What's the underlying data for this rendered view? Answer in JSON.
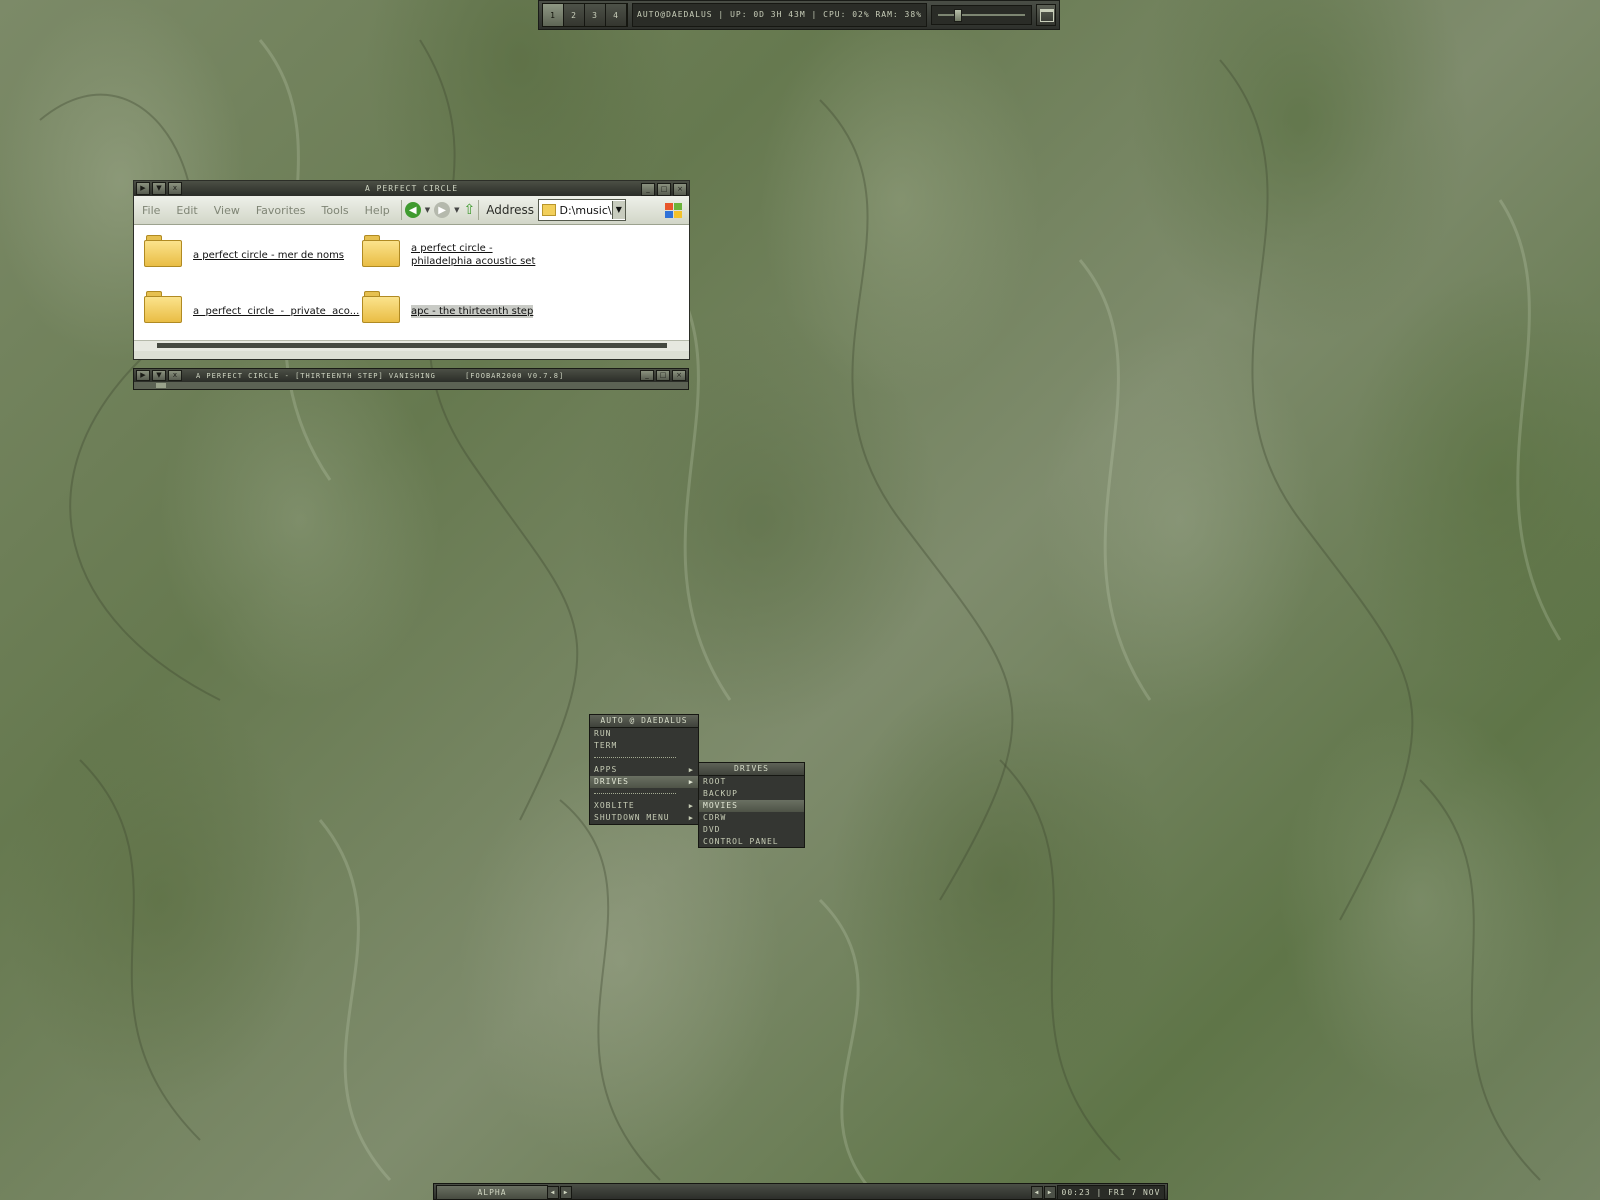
{
  "topbar": {
    "workspaces": [
      "1",
      "2",
      "3",
      "4"
    ],
    "active_workspace": "1",
    "status_text": "AUTO@DAEDALUS | UP: 0D 3H 43M | CPU: 02% RAM: 38%",
    "volume_level": 0.2,
    "maximize_icon": "window-icon"
  },
  "explorer": {
    "title": "A PERFECT CIRCLE",
    "menu": [
      "File",
      "Edit",
      "View",
      "Favorites",
      "Tools",
      "Help"
    ],
    "address_label": "Address",
    "address_value": "D:\\music\\",
    "folders": [
      {
        "name": "a perfect circle - mer de noms"
      },
      {
        "name": "a perfect circle - philadelphia acoustic set"
      },
      {
        "name": "a  perfect  circle  -  private  aco..."
      },
      {
        "name": "apc - the thirteenth step"
      }
    ],
    "selected_folder": "apc - the thirteenth step"
  },
  "foobar": {
    "title": "A PERFECT CIRCLE - [THIRTEENTH STEP] VANISHING",
    "version": "[FOOBAR2000 V0.7.8]"
  },
  "main_menu": {
    "header": "AUTO @ DAEDALUS",
    "items": [
      {
        "label": "RUN"
      },
      {
        "label": "TERM"
      },
      {
        "label": "APPS",
        "submenu": true
      },
      {
        "label": "DRIVES",
        "submenu": true,
        "highlighted": true
      },
      {
        "label": "XOBLITE",
        "submenu": true
      },
      {
        "label": "SHUTDOWN MENU",
        "submenu": true
      }
    ]
  },
  "drives_menu": {
    "header": "DRIVES",
    "items": [
      "ROOT",
      "BACKUP",
      "MOVIES",
      "CDRW",
      "DVD",
      "CONTROL PANEL"
    ],
    "highlighted": "MOVIES"
  },
  "taskbar": {
    "task_label": "ALPHA",
    "clock": "00:23 | FRI 7 NOV"
  },
  "colors": {
    "wallpaper": "#6f7f5b",
    "chrome_dark": "#2e302b",
    "chrome_text": "#c9cfbb",
    "menu_highlight": "#6a7062"
  }
}
